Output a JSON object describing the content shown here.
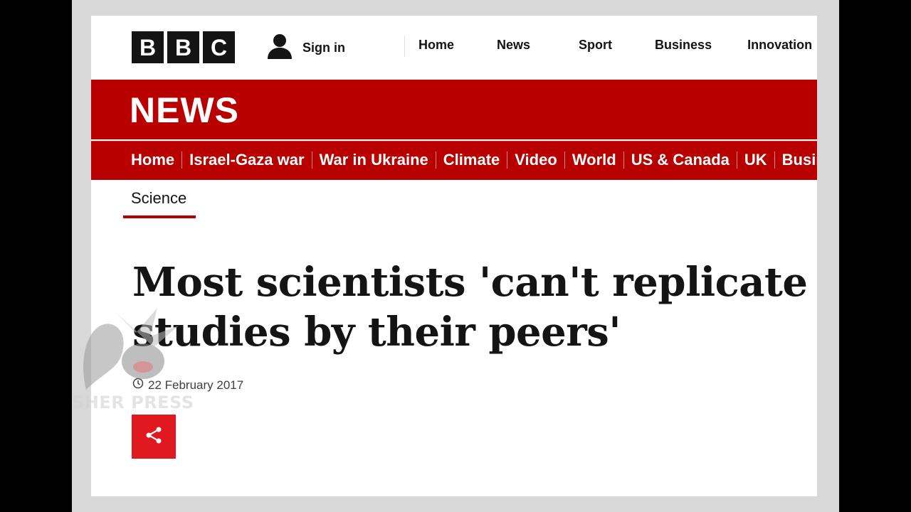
{
  "topbar": {
    "logo_letters": [
      "B",
      "B",
      "C"
    ],
    "signin_label": "Sign in",
    "nav": [
      "Home",
      "News",
      "Sport",
      "Business",
      "Innovation"
    ]
  },
  "banner": {
    "title": "NEWS",
    "nav": [
      "Home",
      "Israel-Gaza war",
      "War in Ukraine",
      "Climate",
      "Video",
      "World",
      "US & Canada",
      "UK",
      "Business"
    ]
  },
  "article": {
    "section": "Science",
    "headline_line1": "Most scientists 'can't replicate",
    "headline_line2": "studies by their peers'",
    "date": "22 February 2017"
  },
  "watermark": {
    "text": "SHER PRESS"
  },
  "colors": {
    "brand_red": "#b80000",
    "share_red": "#e0181f",
    "logo_black": "#141414"
  }
}
